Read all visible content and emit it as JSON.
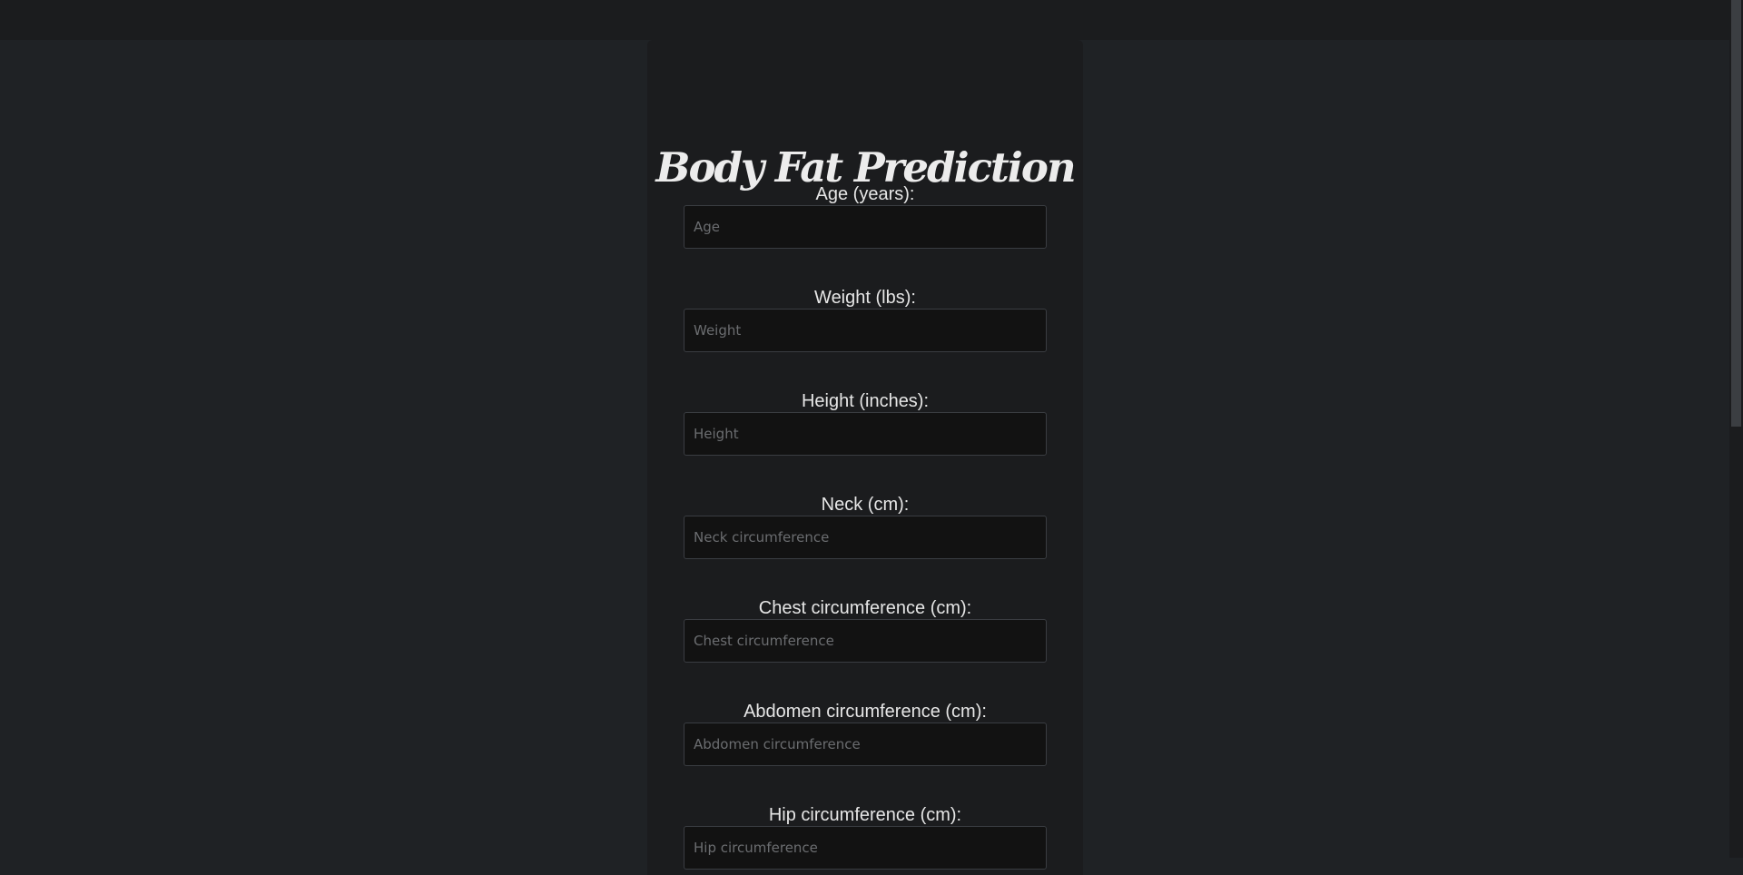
{
  "page": {
    "title": "Body Fat Prediction"
  },
  "form": {
    "fields": [
      {
        "label": "Age (years):",
        "placeholder": "Age"
      },
      {
        "label": "Weight (lbs):",
        "placeholder": "Weight"
      },
      {
        "label": "Height (inches):",
        "placeholder": "Height"
      },
      {
        "label": "Neck (cm):",
        "placeholder": "Neck circumference"
      },
      {
        "label": "Chest circumference (cm):",
        "placeholder": "Chest circumference"
      },
      {
        "label": "Abdomen circumference (cm):",
        "placeholder": "Abdomen circumference"
      },
      {
        "label": "Hip circumference (cm):",
        "placeholder": "Hip circumference"
      }
    ]
  },
  "colors": {
    "background": "#1f2225",
    "card": "#1b1c1e",
    "input_background": "#121212",
    "text": "#e6e6e6"
  }
}
